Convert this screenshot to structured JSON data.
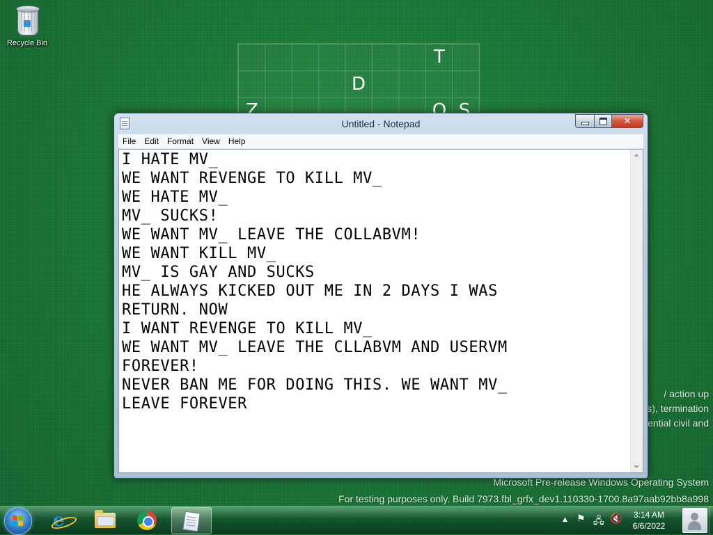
{
  "desktop": {
    "icons": [
      {
        "label": "Recycle Bin",
        "icon": "recycle-bin-icon"
      }
    ],
    "board_letters": [
      "T",
      "D",
      "Z",
      "O",
      "S"
    ],
    "background_color": "#1d7a3a"
  },
  "watermark": {
    "partial_lines": [
      "/ action up",
      "s), termination",
      "ential civil and"
    ],
    "line1": "Microsoft Pre-release Windows Operating System",
    "line2": "For testing purposes only. Build 7973.fbl_grfx_dev1.110330-1700.8a97aab92bb8a998"
  },
  "notepad": {
    "title": "Untitled - Notepad",
    "menu": [
      "File",
      "Edit",
      "Format",
      "View",
      "Help"
    ],
    "content": "I HATE MV_\nWE WANT REVENGE TO KILL MV_\nWE HATE MV_\nMV_ SUCKS!\nWE WANT MV_ LEAVE THE COLLABVM!\nWE WANT KILL MV_\nMV_ IS GAY AND SUCKS\nHE ALWAYS KICKED OUT ME IN 2 DAYS I WAS\nRETURN. NOW\nI WANT REVENGE TO KILL MV_\nWE WANT MV_ LEAVE THE CLLABVM AND USERVM\nFOREVER!\nNEVER BAN ME FOR DOING THIS. WE WANT MV_\nLEAVE FOREVER",
    "controls": {
      "minimize": "minimize-icon",
      "maximize": "maximize-icon",
      "close": "close-icon"
    }
  },
  "taskbar": {
    "pinned": [
      {
        "name": "internet-explorer",
        "icon": "internet-explorer-icon"
      },
      {
        "name": "windows-explorer",
        "icon": "folder-icon"
      },
      {
        "name": "google-chrome",
        "icon": "chrome-icon"
      },
      {
        "name": "notepad",
        "icon": "notepad-icon",
        "active": true
      }
    ],
    "tray": {
      "icons": [
        "show-hidden-icons-arrow",
        "action-center-flag-icon",
        "network-icon",
        "volume-muted-icon"
      ],
      "time": "3:14 AM",
      "date": "6/6/2022"
    }
  }
}
